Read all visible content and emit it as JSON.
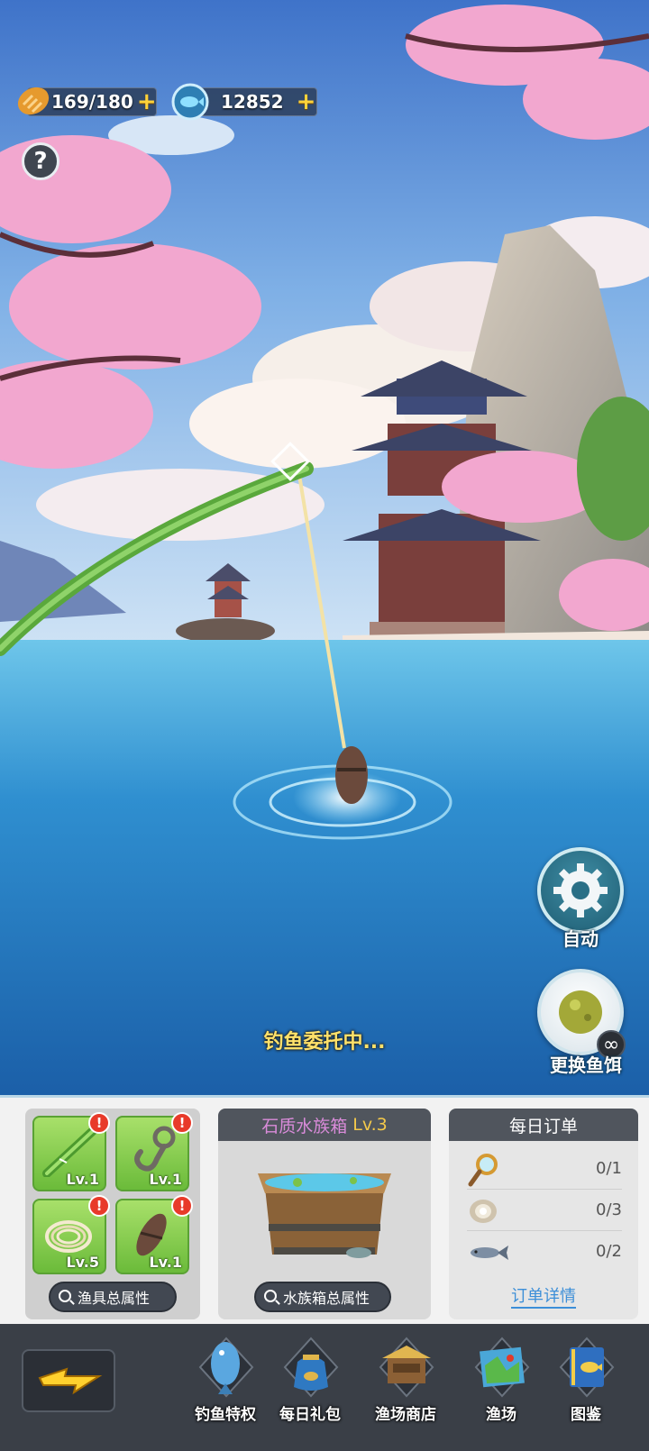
{
  "hud": {
    "bread": "169/180",
    "coins": "12852",
    "plus": "+",
    "help": "?"
  },
  "scene": {
    "status": "钓鱼委托中..."
  },
  "right_buttons": {
    "auto_label": "自动",
    "bait_label": "更换鱼饵",
    "bait_count": "∞"
  },
  "gear": {
    "slots": [
      {
        "icon": "bamboo-rod-icon",
        "level": "Lv.1"
      },
      {
        "icon": "hook-icon",
        "level": "Lv.1"
      },
      {
        "icon": "fishing-line-icon",
        "level": "Lv.5"
      },
      {
        "icon": "bobber-icon",
        "level": "Lv.1"
      }
    ],
    "alert": "!",
    "stats_button": "渔具总属性"
  },
  "aquarium": {
    "name": "石质水族箱",
    "level": "Lv.3",
    "stats_button": "水族箱总属性"
  },
  "orders": {
    "title": "每日订单",
    "items": [
      {
        "icon": "magnifier-icon",
        "progress": "0/1"
      },
      {
        "icon": "shell-icon",
        "progress": "0/3"
      },
      {
        "icon": "fish-icon",
        "progress": "0/2"
      }
    ],
    "detail_link": "订单详情"
  },
  "nav": {
    "items": [
      {
        "icon": "fishing-privilege-icon",
        "label": "钓鱼特权"
      },
      {
        "icon": "daily-gift-icon",
        "label": "每日礼包"
      },
      {
        "icon": "fishery-shop-icon",
        "label": "渔场商店"
      },
      {
        "icon": "fishery-map-icon",
        "label": "渔场"
      },
      {
        "icon": "encyclopedia-icon",
        "label": "图鉴"
      }
    ]
  }
}
